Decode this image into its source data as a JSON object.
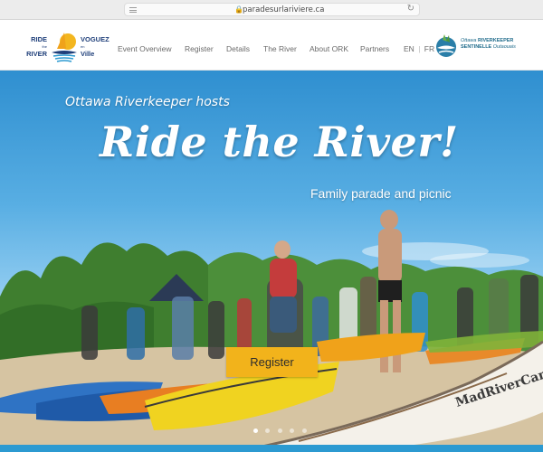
{
  "browser": {
    "url": "paradesurlariviere.ca",
    "lock_icon": "lock-icon",
    "reload_icon": "reload-icon"
  },
  "logo": {
    "left_line1": "RIDE",
    "left_small": "the",
    "left_line2": "RIVER",
    "right_line1": "VOGUEZ",
    "right_small": "en",
    "right_line2": "Ville"
  },
  "nav": {
    "items": [
      {
        "label": "Event Overview"
      },
      {
        "label": "Register"
      },
      {
        "label": "Details"
      },
      {
        "label": "The River"
      },
      {
        "label": "About ORK"
      },
      {
        "label": "Partners"
      }
    ],
    "lang_en": "EN",
    "lang_sep": "|",
    "lang_fr": "FR"
  },
  "partner_logo": {
    "line1_a": "Ottawa",
    "line1_b": "RIVERKEEPER",
    "line2_a": "SENTINELLE",
    "line2_b": "Outaouais"
  },
  "hero": {
    "subtitle": "Ottawa Riverkeeper hosts",
    "title": "Ride the River!",
    "tagline": "Family parade and picnic",
    "register_label": "Register",
    "canoe_brand": "MadRiverCanoe",
    "slides": 5,
    "active_slide": 0
  },
  "colors": {
    "brand_navy": "#1f3f7a",
    "button_yellow": "#f2b31b",
    "accent_blue": "#2c9ad1"
  }
}
